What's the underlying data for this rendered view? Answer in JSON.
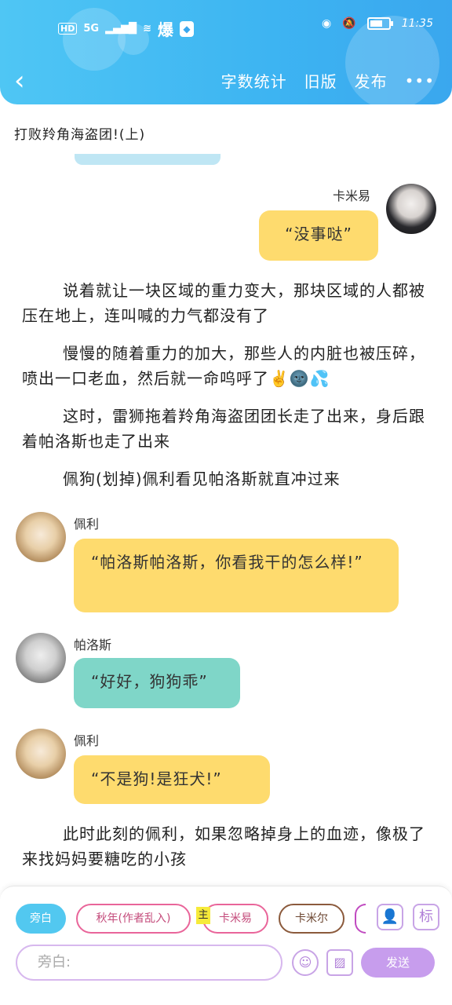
{
  "status_bar": {
    "network": "HD",
    "signal": "5G",
    "wifi_icon": "wifi-icon",
    "fire_icon": "fire-icon",
    "time": "11:35"
  },
  "nav": {
    "back_icon": "chevron-left-icon",
    "word_count": "字数统计",
    "old_version": "旧版",
    "publish": "发布",
    "more": "•••"
  },
  "chapter_title": "打败羚角海盗团!(上)",
  "messages": {
    "m1": {
      "name": "卡米易",
      "text": "“没事哒”"
    },
    "p1": "说着就让一块区域的重力变大，那块区域的人都被压在地上，连叫喊的力气都没有了",
    "p2": "慢慢的随着重力的加大，那些人的内脏也被压碎，喷出一口老血，然后就一命呜呼了✌️🌚💦",
    "p3": "这时，雷狮拖着羚角海盗团团长走了出来，身后跟着帕洛斯也走了出来",
    "p4": "佩狗(划掉)佩利看见帕洛斯就直冲过来",
    "m2": {
      "name": "佩利",
      "text": "“帕洛斯帕洛斯，你看我干的怎么样!”"
    },
    "m3": {
      "name": "帕洛斯",
      "text": "“好好，狗狗乖”"
    },
    "m4": {
      "name": "佩利",
      "text": "“不是狗!是狂犬!”"
    },
    "p5": "此时此刻的佩利，如果忽略掉身上的血迹，像极了来找妈妈要糖吃的小孩"
  },
  "composer": {
    "chips": {
      "narration": "旁白",
      "autumn": "秋年(作者乱入)",
      "main_tag": "主",
      "kamiyi": "卡米易",
      "kamier": "卡米尔"
    },
    "placeholder": "旁白:",
    "send": "发送",
    "tag_icon": "标"
  },
  "colors": {
    "header": "#3db4f2",
    "yellow_bubble": "#fedb6e",
    "teal_bubble": "#7fd6c8",
    "send": "#c79ded"
  }
}
